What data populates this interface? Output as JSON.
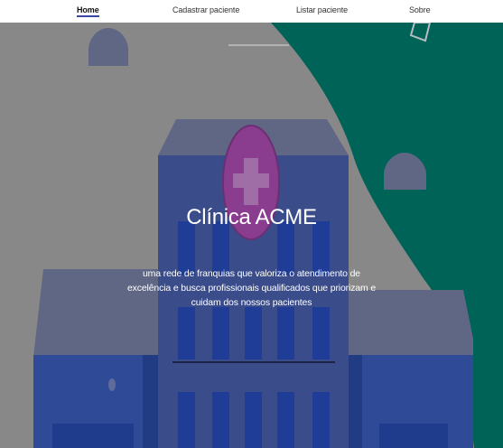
{
  "nav": {
    "home": "Home",
    "cadastrar": "Cadastrar paciente",
    "listar": "Listar paciente",
    "sobre": "Sobre"
  },
  "hero": {
    "title": "Clínica ACME",
    "description": "uma rede de franquias que valoriza o atendimento de excelência e busca profissionais qualificados que priorizam e cuidam dos nossos pacientes"
  },
  "colors": {
    "accent": "#3a46a8",
    "teal": "#006358",
    "gray": "#888888",
    "building": "#3a4c8a",
    "cross_circle": "#8a3d8e"
  }
}
